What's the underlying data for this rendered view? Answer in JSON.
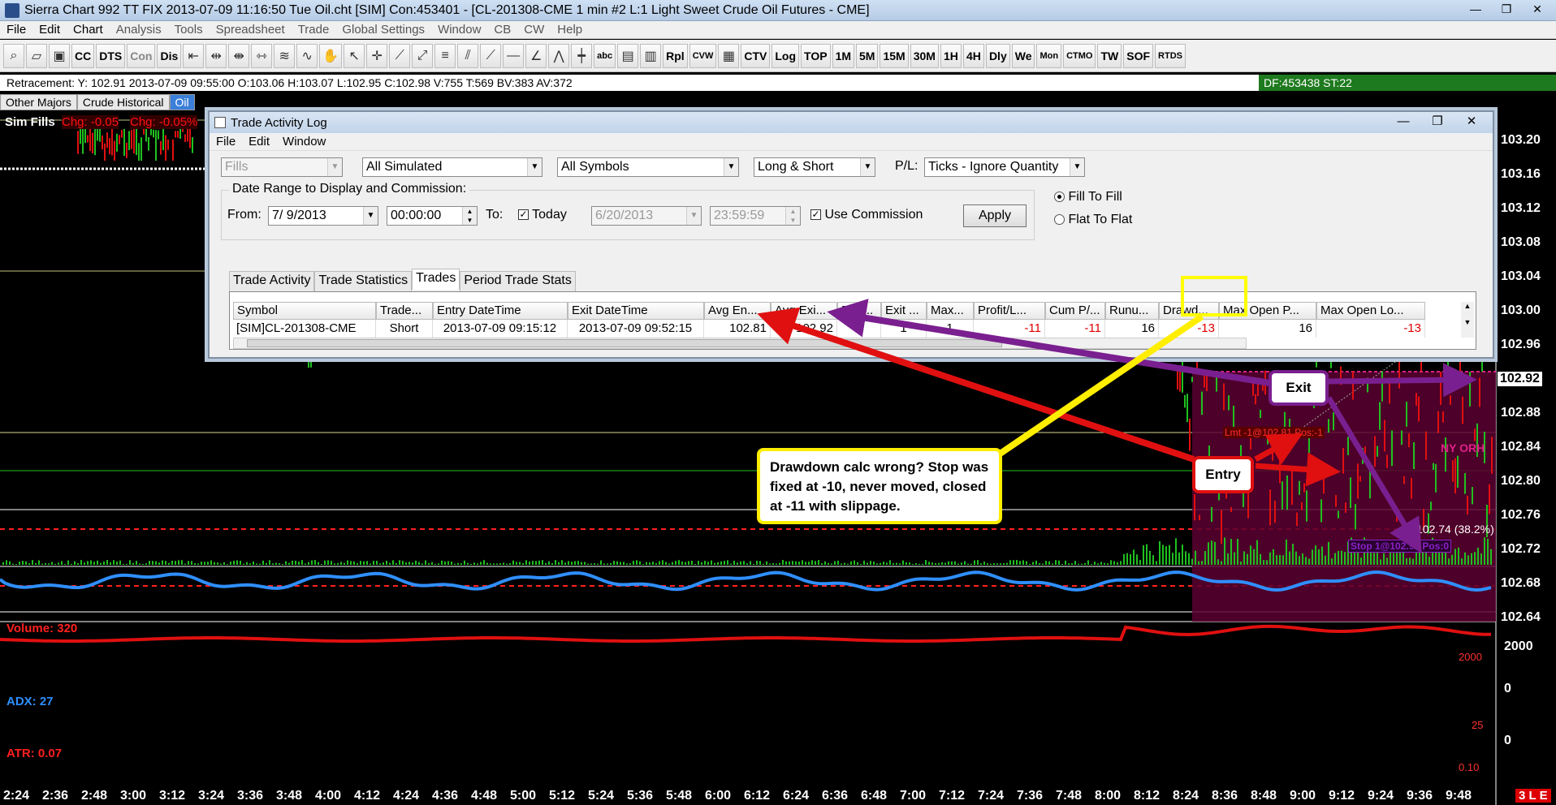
{
  "window": {
    "title": "Sierra Chart 992 TT FIX 2013-07-09  11:16:50 Tue  Oil.cht [SIM] Con:453401 - [CL-201308-CME  1 min  #2  L:1  Light Sweet Crude Oil Futures - CME]"
  },
  "window_controls": [
    "—",
    "❐",
    "✕"
  ],
  "menu": [
    "File",
    "Edit",
    "Chart",
    "Analysis",
    "Tools",
    "Spreadsheet",
    "Trade",
    "Global Settings",
    "Window",
    "CB",
    "CW",
    "Help"
  ],
  "toolbar": {
    "buttons": [
      "CC",
      "DTS",
      "Con",
      "Dis",
      "1M",
      "5M",
      "15M",
      "30M",
      "1H",
      "4H",
      "Dly",
      "We",
      "Mon",
      "CTMO",
      "TW",
      "SOF",
      "RTDS",
      "Rpl",
      "CVW",
      "CTV",
      "Log",
      "TOP",
      "abc"
    ]
  },
  "infobar": {
    "text": "Retracement: Y: 102.91  2013-07-09  09:55:00  O:103.06  H:103.07  L:102.95  C:102.98  V:755  T:569  BV:383  AV:372"
  },
  "df_box": "DF:453438  ST:22",
  "chart_tabs": [
    "Other Majors",
    "Crude Historical",
    "Oil"
  ],
  "chart": {
    "sim_fills": "Sim Fills",
    "chg_abs": "Chg: -0.05",
    "chg_pct": "Chg: -0.05%",
    "volume_label": "Volume: 320",
    "adx_label": "ADX: 27",
    "atr_label": "ATR: 0.07",
    "price_labels": [
      "103.20",
      "103.16",
      "103.12",
      "103.08",
      "103.04",
      "103.00",
      "102.96",
      "102.92",
      "102.88",
      "102.84",
      "102.80",
      "102.76",
      "102.72",
      "102.68",
      "102.64"
    ],
    "current_price": "102.92",
    "volume_scale": "2000",
    "volume_scale2": "0",
    "adx_scale": "0",
    "time_labels": [
      "2:24",
      "2:36",
      "2:48",
      "3:00",
      "3:12",
      "3:24",
      "3:36",
      "3:48",
      "4:00",
      "4:12",
      "4:24",
      "4:36",
      "4:48",
      "5:00",
      "5:12",
      "5:24",
      "5:36",
      "5:48",
      "6:00",
      "6:12",
      "6:24",
      "6:36",
      "6:48",
      "7:00",
      "7:12",
      "7:24",
      "7:36",
      "7:48",
      "8:00",
      "8:12",
      "8:24",
      "8:36",
      "8:48",
      "9:00",
      "9:12",
      "9:24",
      "9:36",
      "9:48"
    ],
    "ny_orh": "NY ORH",
    "retr_label": "102.74  (38.2%)",
    "stop_label": "Stop 1@102.92 Pos:0",
    "lmt_label": "Lmt -1@102.81 Pos:-1",
    "vol_mid": "2000",
    "adx_mid": "25",
    "atr_mid": "0.10",
    "badge": "3 L E"
  },
  "dialog": {
    "title": "Trade Activity Log",
    "menu": [
      "File",
      "Edit",
      "Window"
    ],
    "fills_select": "Fills",
    "sim_select": "All Simulated",
    "symbols_select": "All Symbols",
    "side_select": "Long & Short",
    "pl_label": "P/L:",
    "pl_select": "Ticks - Ignore Quantity",
    "date_group_label": "Date Range to Display and Commission:",
    "from_label": "From:",
    "from_date": "7/  9/2013",
    "from_time": "00:00:00",
    "to_label": "To:",
    "today_label": "Today",
    "to_date": "6/20/2013",
    "to_time": "23:59:59",
    "use_commission": "Use Commission",
    "apply": "Apply",
    "fill_to_fill": "Fill To Fill",
    "flat_to_flat": "Flat To Flat",
    "tabs": [
      "Trade Activity",
      "Trade Statistics",
      "Trades",
      "Period Trade Stats"
    ],
    "columns": [
      "Symbol",
      "Trade...",
      "Entry DateTime",
      "Exit DateTime",
      "Avg En...",
      "Avg Exi...",
      "Entr...",
      "Exit ...",
      "Max...",
      "Profit/L...",
      "Cum P/...",
      "Runu...",
      "Drawd...",
      "Max Open P...",
      "Max Open Lo..."
    ],
    "row": [
      "[SIM]CL-201308-CME",
      "Short",
      "2013-07-09 09:15:12",
      "2013-07-09 09:52:15",
      "102.81",
      "102.92",
      "1",
      "1",
      "1",
      "-11",
      "-11",
      "16",
      "-13",
      "16",
      "-13"
    ]
  },
  "annotations": {
    "note": "Drawdown calc wrong? Stop was fixed at -10, never moved, closed at -11 with slippage.",
    "entry": "Entry",
    "exit": "Exit"
  },
  "colors": {
    "accent_red": "#ff1010",
    "annotation_yellow": "#ffee00",
    "annotation_purple": "#7a1f8f",
    "vol_bars": "#20c020",
    "adx": "#2f8fff",
    "atr": "#e01010"
  }
}
